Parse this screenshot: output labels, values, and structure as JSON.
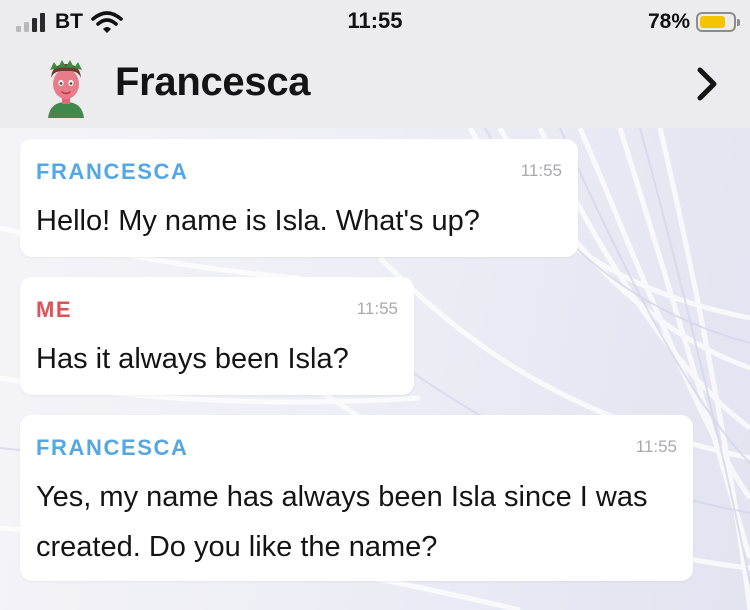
{
  "status_bar": {
    "carrier": "BT",
    "time": "11:55",
    "battery_percent": "78%",
    "battery_level": 0.78,
    "signal_bars_filled": 2,
    "signal_bars_total": 4,
    "icons": [
      "signal-icon",
      "wifi-icon",
      "battery-icon"
    ]
  },
  "header": {
    "contact_name": "Francesca",
    "icons": [
      "avatar",
      "chevron-right-icon"
    ]
  },
  "messages": [
    {
      "sender": "FRANCESCA",
      "time": "11:55",
      "text": "Hello! My name is Isla. What's up?",
      "from_me": false
    },
    {
      "sender": "ME",
      "time": "11:55",
      "text": "Has it always been Isla?",
      "from_me": true
    },
    {
      "sender": "FRANCESCA",
      "time": "11:55",
      "text": "Yes, my name has always been Isla since I was created. Do you like the name?",
      "from_me": false
    }
  ],
  "colors": {
    "sender_them": "#55a7e4",
    "sender_me": "#e0525a",
    "battery_fill": "#f5c400",
    "header_bg": "#ececee"
  }
}
